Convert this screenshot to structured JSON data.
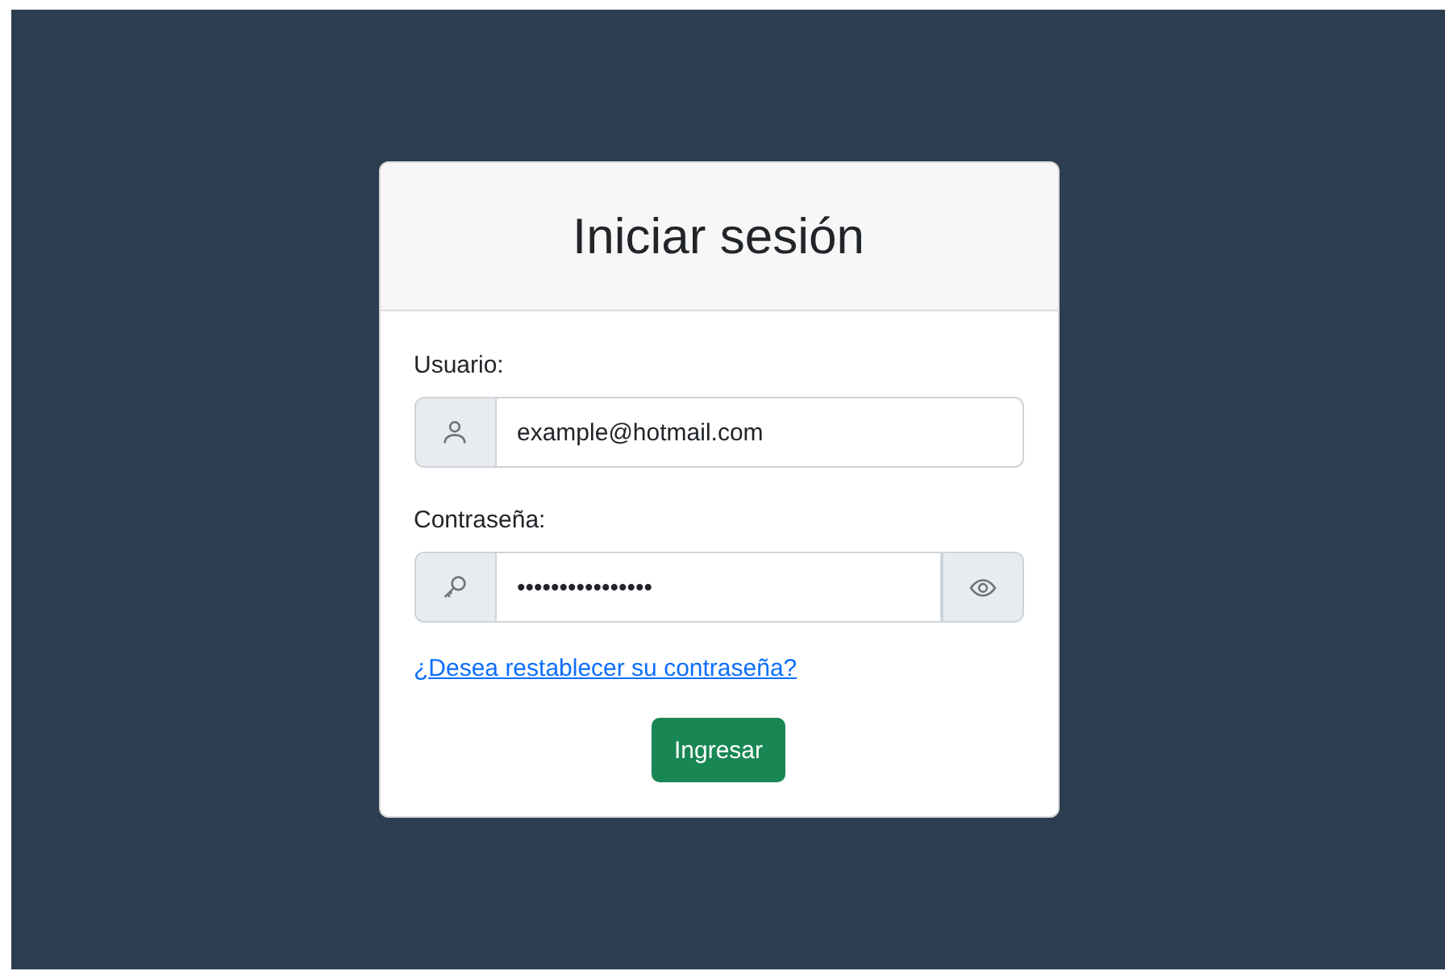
{
  "card": {
    "title": "Iniciar sesión"
  },
  "fields": [
    {
      "label": "Usuario:",
      "kind": "user",
      "value": "example@hotmail.com",
      "reveal_button": false
    },
    {
      "label": "Contraseña:",
      "kind": "password",
      "value": "••••••••••••••••",
      "reveal_button": true
    }
  ],
  "link": "¿Desea restablecer su contraseña?",
  "button": "Ingresar"
}
